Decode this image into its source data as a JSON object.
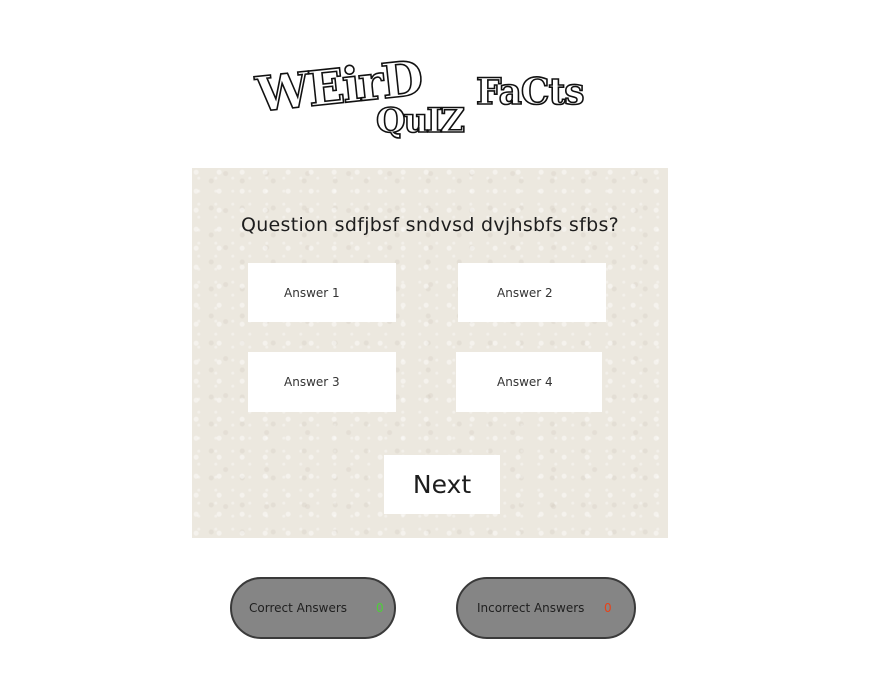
{
  "logo": {
    "letters_weird": "WEirD",
    "letters_facts": "FaCts",
    "letters_quiz": "QuIZ"
  },
  "quiz": {
    "question": "Question sdfjbsf sndvsd dvjhsbfs sfbs?",
    "answers": [
      "Answer 1",
      "Answer 2",
      "Answer 3",
      "Answer 4"
    ],
    "next_label": "Next"
  },
  "scores": {
    "correct_label": "Correct Answers",
    "correct_count": "0",
    "incorrect_label": "Incorrect Answers",
    "incorrect_count": "0"
  },
  "colors": {
    "correct": "#4cd137",
    "incorrect": "#e84118",
    "score_pill": "#858585",
    "card": "#ece8df"
  }
}
